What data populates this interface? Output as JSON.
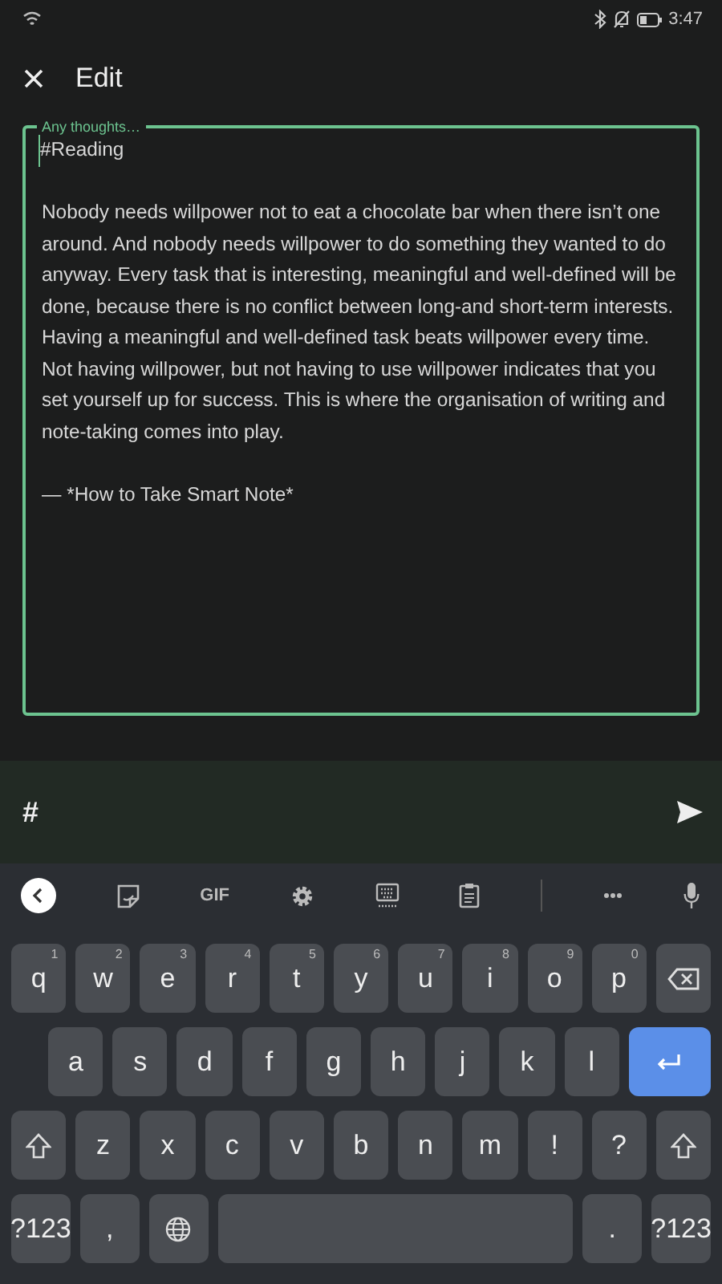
{
  "status_bar": {
    "time": "3:47"
  },
  "header": {
    "title": "Edit"
  },
  "note_field": {
    "label": "Any thoughts…",
    "paragraphs": [
      "#Reading",
      "Nobody needs willpower not to eat a chocolate bar when there isn’t one around. And nobody needs willpower to do something they wanted to do anyway. Every task that is interesting, meaningful and well-defined will be done, because there is no conflict between long-and short-term interests. Having a meaningful and well-defined task beats willpower every time. Not having willpower, but not having to use willpower indicates that you set yourself up for success. This is where the organisation of writing and note-taking comes into play.",
      "— *How to Take Smart Note*"
    ]
  },
  "hashtag_bar": {
    "symbol": "#"
  },
  "keyboard": {
    "toolbar": [
      {
        "kind": "back"
      },
      {
        "kind": "sticker"
      },
      {
        "kind": "gif",
        "label": "GIF"
      },
      {
        "kind": "settings"
      },
      {
        "kind": "keyboard"
      },
      {
        "kind": "clipboard"
      },
      {
        "kind": "divider"
      },
      {
        "kind": "more"
      },
      {
        "kind": "mic"
      }
    ],
    "rows": [
      [
        {
          "kind": "char",
          "label": "q",
          "hint": "1"
        },
        {
          "kind": "char",
          "label": "w",
          "hint": "2"
        },
        {
          "kind": "char",
          "label": "e",
          "hint": "3"
        },
        {
          "kind": "char",
          "label": "r",
          "hint": "4"
        },
        {
          "kind": "char",
          "label": "t",
          "hint": "5"
        },
        {
          "kind": "char",
          "label": "y",
          "hint": "6"
        },
        {
          "kind": "char",
          "label": "u",
          "hint": "7"
        },
        {
          "kind": "char",
          "label": "i",
          "hint": "8"
        },
        {
          "kind": "char",
          "label": "o",
          "hint": "9"
        },
        {
          "kind": "char",
          "label": "p",
          "hint": "0"
        },
        {
          "kind": "backspace"
        }
      ],
      [
        {
          "kind": "gap"
        },
        {
          "kind": "char",
          "label": "a"
        },
        {
          "kind": "char",
          "label": "s"
        },
        {
          "kind": "char",
          "label": "d"
        },
        {
          "kind": "char",
          "label": "f"
        },
        {
          "kind": "char",
          "label": "g"
        },
        {
          "kind": "char",
          "label": "h"
        },
        {
          "kind": "char",
          "label": "j"
        },
        {
          "kind": "char",
          "label": "k"
        },
        {
          "kind": "char",
          "label": "l"
        },
        {
          "kind": "enter"
        }
      ],
      [
        {
          "kind": "shift"
        },
        {
          "kind": "char",
          "label": "z"
        },
        {
          "kind": "char",
          "label": "x"
        },
        {
          "kind": "char",
          "label": "c"
        },
        {
          "kind": "char",
          "label": "v"
        },
        {
          "kind": "char",
          "label": "b"
        },
        {
          "kind": "char",
          "label": "n"
        },
        {
          "kind": "char",
          "label": "m"
        },
        {
          "kind": "char",
          "label": "!"
        },
        {
          "kind": "char",
          "label": "?"
        },
        {
          "kind": "shift"
        }
      ],
      [
        {
          "kind": "char",
          "label": "?123"
        },
        {
          "kind": "char",
          "label": ","
        },
        {
          "kind": "globe"
        },
        {
          "kind": "space"
        },
        {
          "kind": "char",
          "label": "."
        },
        {
          "kind": "char",
          "label": "?123"
        }
      ]
    ]
  }
}
